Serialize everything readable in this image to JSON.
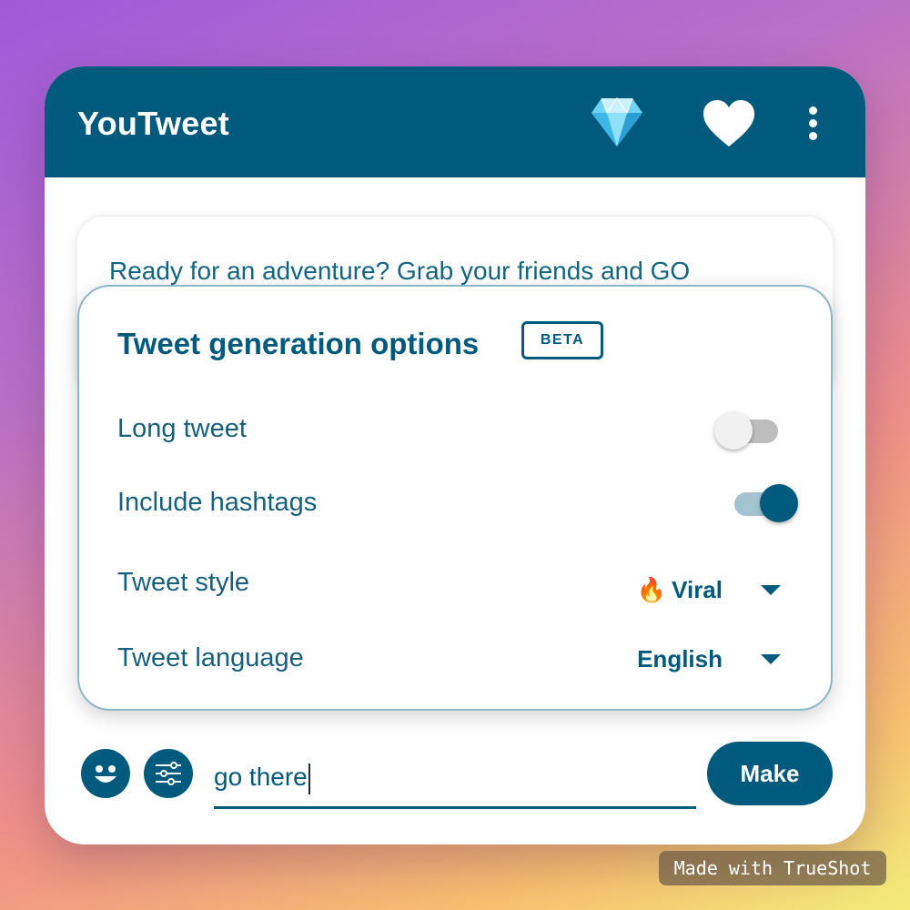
{
  "app": {
    "title": "YouTweet",
    "icons": {
      "premium": "diamond-icon",
      "favorites": "heart-icon",
      "menu": "more-vertical-icon"
    }
  },
  "tweet": {
    "text": "Ready for an adventure? Grab your friends and GO"
  },
  "options": {
    "title": "Tweet generation options",
    "badge": "BETA",
    "long_tweet": {
      "label": "Long tweet",
      "enabled": false
    },
    "hashtags": {
      "label": "Include hashtags",
      "enabled": true
    },
    "style": {
      "label": "Tweet style",
      "emoji": "🔥",
      "value": "Viral"
    },
    "language": {
      "label": "Tweet language",
      "value": "English"
    }
  },
  "composer": {
    "input_value": "go there",
    "emoji_icon": "smiley-icon",
    "settings_icon": "sliders-icon",
    "make_label": "Make"
  },
  "watermark": "Made with TrueShot",
  "colors": {
    "brand": "#005a7d",
    "toggle_off_track": "#bdbdbd",
    "toggle_on_track": "#a4c3d1"
  }
}
